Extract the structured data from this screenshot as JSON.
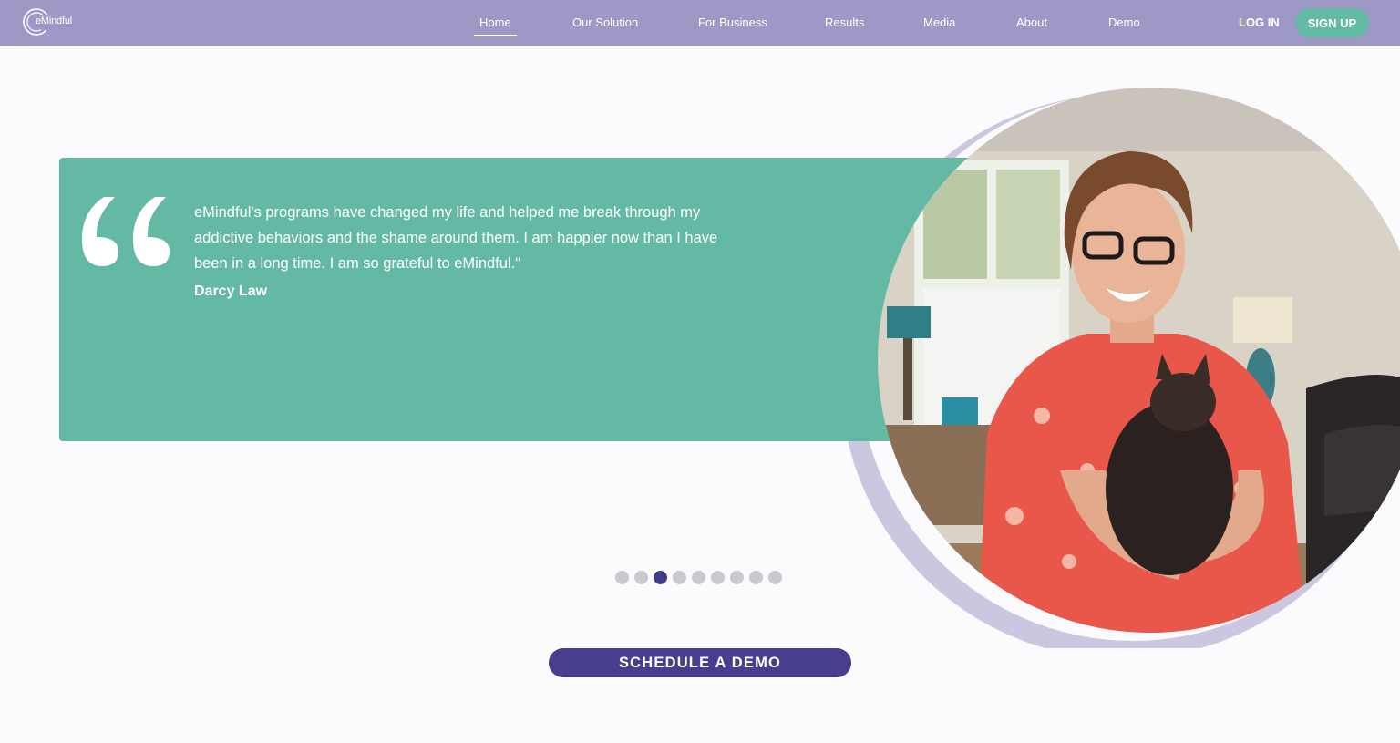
{
  "brand": {
    "logo_text": "eMindful",
    "nav_bg": "#9e98c6",
    "accent_teal": "#64b9a5",
    "accent_purple": "#473e8f"
  },
  "nav": {
    "links": [
      "Home",
      "Our Solution",
      "For Business",
      "Results",
      "Media",
      "About",
      "Demo"
    ],
    "active": "Home",
    "login_label": "LOG IN",
    "signup_label": "SIGN UP"
  },
  "testimonial": {
    "quote_icon": "quote-icon",
    "text": "eMindful's programs have changed my life and helped me break through my addictive behaviors and the shame around them. I am happier now than I have been in a long time. I am so grateful to eMindful.\"",
    "author": "Darcy Law"
  },
  "carousel": {
    "total": 9,
    "active_index": 3
  },
  "cta": {
    "label": "SCHEDULE A DEMO"
  }
}
